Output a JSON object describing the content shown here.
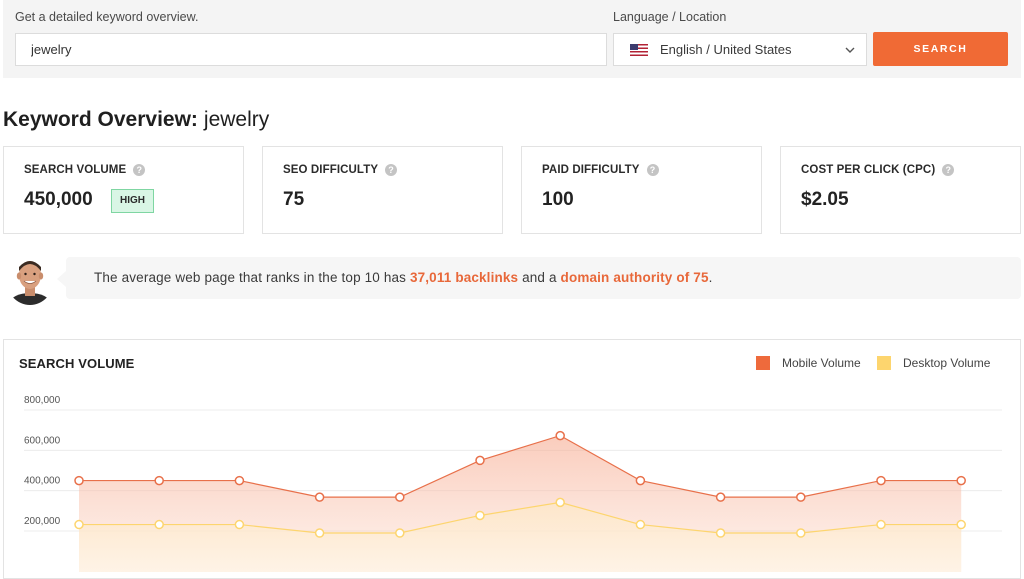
{
  "search": {
    "keyword_label": "Get a detailed keyword overview.",
    "keyword_value": "jewelry",
    "language_label": "Language / Location",
    "language_value": "English / United States",
    "button_label": "SEARCH"
  },
  "overview": {
    "heading": "Keyword Overview:",
    "keyword": "jewelry"
  },
  "metrics": [
    {
      "label": "SEARCH VOLUME",
      "value": "450,000",
      "badge": "HIGH"
    },
    {
      "label": "SEO DIFFICULTY",
      "value": "75"
    },
    {
      "label": "PAID DIFFICULTY",
      "value": "100"
    },
    {
      "label": "COST PER CLICK (CPC)",
      "value": "$2.05"
    }
  ],
  "tip": {
    "prefix": "The average web page that ranks in the top 10 has ",
    "backlinks": "37,011 backlinks",
    "middle": " and a ",
    "authority": "domain authority of 75",
    "suffix": "."
  },
  "colors": {
    "accent": "#f06a35",
    "mobile": "#e8704a",
    "desktop": "#fdd56e",
    "badge_bg": "#d9f6e5"
  },
  "chart": {
    "title": "SEARCH VOLUME",
    "legend": [
      "Mobile Volume",
      "Desktop Volume"
    ]
  },
  "chart_data": {
    "type": "area",
    "title": "SEARCH VOLUME",
    "y_tick_labels": [
      "800,000",
      "600,000",
      "400,000",
      "200,000"
    ],
    "y_ticks": [
      800000,
      600000,
      400000,
      200000
    ],
    "ylim": [
      0,
      900000
    ],
    "grid": true,
    "legend_position": "top-right",
    "series": [
      {
        "name": "Mobile Volume",
        "values": [
          450000,
          450000,
          450000,
          368000,
          368000,
          550000,
          673000,
          450000,
          368000,
          368000,
          450000,
          450000
        ]
      },
      {
        "name": "Desktop Volume",
        "values": [
          232000,
          232000,
          232000,
          190000,
          190000,
          277000,
          342000,
          232000,
          190000,
          190000,
          232000,
          232000
        ]
      }
    ]
  }
}
